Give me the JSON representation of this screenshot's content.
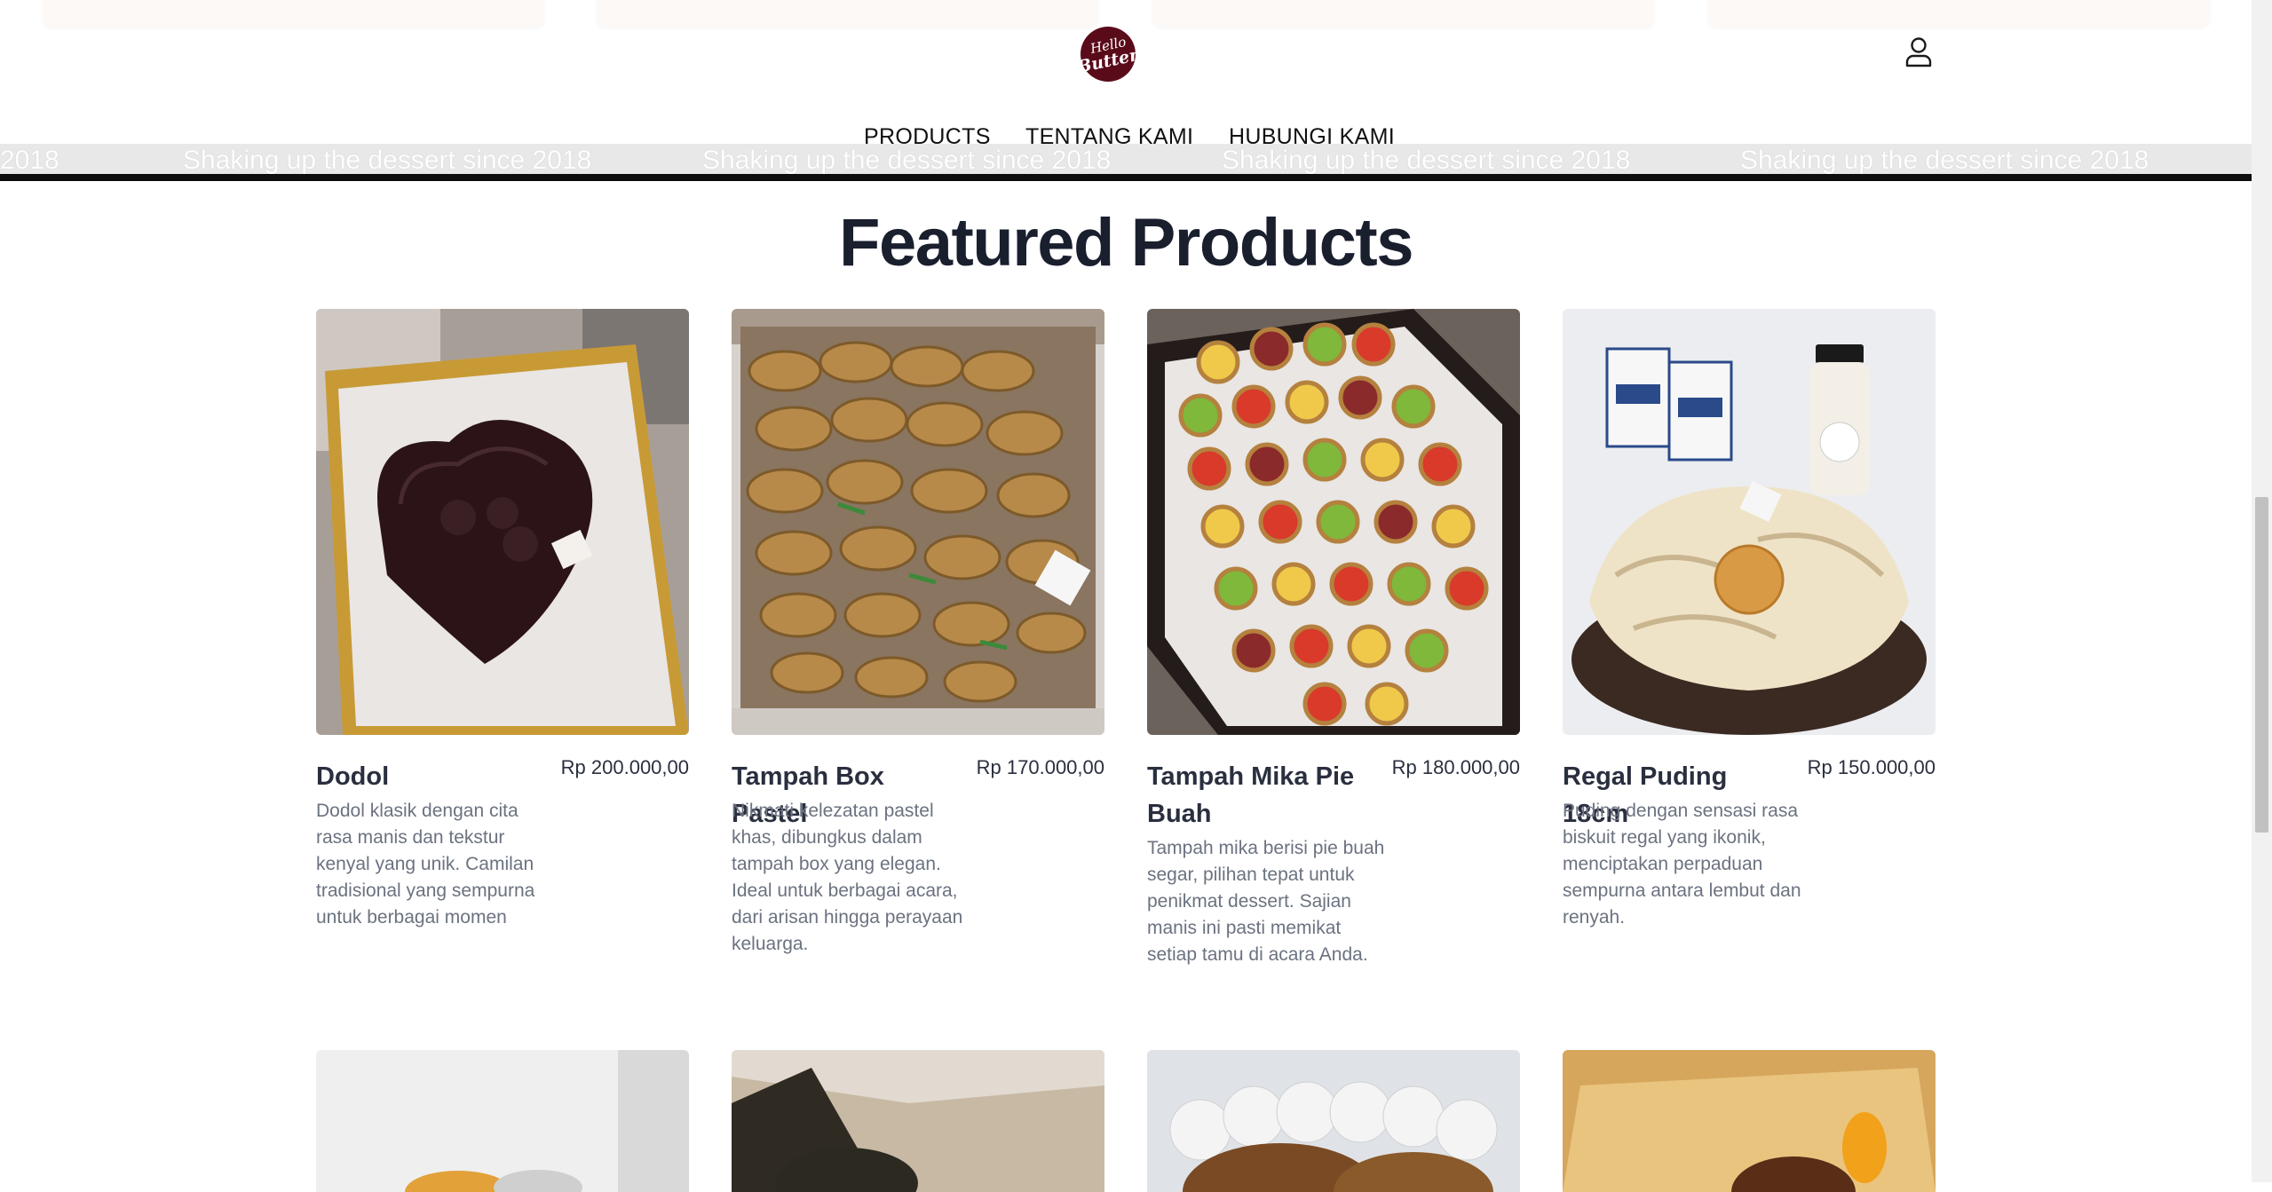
{
  "brand": {
    "logo_line1": "Hello",
    "logo_line2": "Butter"
  },
  "nav": {
    "items": [
      "PRODUCTS",
      "TENTANG KAMI",
      "HUBUNGI KAMI"
    ]
  },
  "marquee": {
    "text": "Shaking up the dessert since 2018",
    "fragment": "2018"
  },
  "section": {
    "title": "Featured Products"
  },
  "products": [
    {
      "name": "Dodol",
      "price": "Rp 200.000,00",
      "description": "Dodol klasik dengan cita rasa manis dan tekstur kenyal yang unik. Camilan tradisional yang sempurna untuk berbagai momen"
    },
    {
      "name": "Tampah Box Pastel",
      "price": "Rp 170.000,00",
      "description": "Nikmati kelezatan pastel khas, dibungkus dalam tampah box yang elegan. Ideal untuk berbagai acara, dari arisan hingga perayaan keluarga."
    },
    {
      "name": "Tampah Mika Pie Buah",
      "price": "Rp 180.000,00",
      "description": "Tampah mika berisi pie buah segar, pilihan tepat untuk penikmat dessert. Sajian manis ini pasti memikat setiap tamu di acara Anda."
    },
    {
      "name": "Regal Puding 18cm",
      "price": "Rp 150.000,00",
      "description": "Puding dengan sensasi rasa biskuit regal yang ikonik, menciptakan perpaduan sempurna antara lembut dan renyah."
    }
  ],
  "icons": {
    "account": "user-account-icon"
  },
  "colors": {
    "heading": "#1a1f2e",
    "logo_bg": "#5a0b1a",
    "marquee_bg": "#e8e8e8",
    "body_text": "#6b7280"
  }
}
